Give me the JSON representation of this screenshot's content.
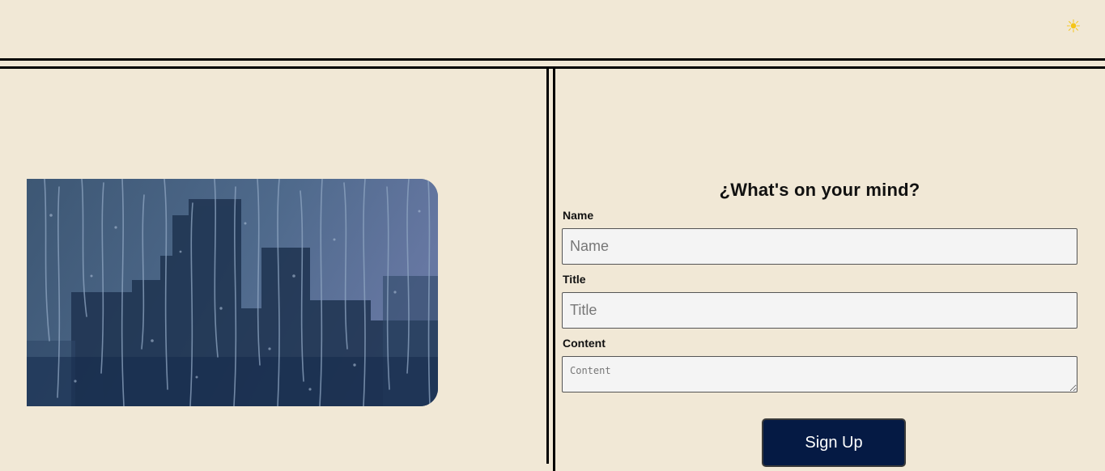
{
  "header": {
    "theme_toggle_icon": "sun-icon",
    "theme_toggle_glyph": "☀"
  },
  "hero": {
    "image": "rainy-city-window-photo"
  },
  "form": {
    "title": "¿What's on your mind?",
    "fields": {
      "name": {
        "label": "Name",
        "placeholder": "Name",
        "value": ""
      },
      "title": {
        "label": "Title",
        "placeholder": "Title",
        "value": ""
      },
      "content": {
        "label": "Content",
        "placeholder": "Content",
        "value": ""
      }
    },
    "submit_label": "Sign Up"
  },
  "colors": {
    "background": "#f1e8d6",
    "button": "#051a44",
    "input_bg": "#f4f4f4",
    "rule": "#000000"
  }
}
